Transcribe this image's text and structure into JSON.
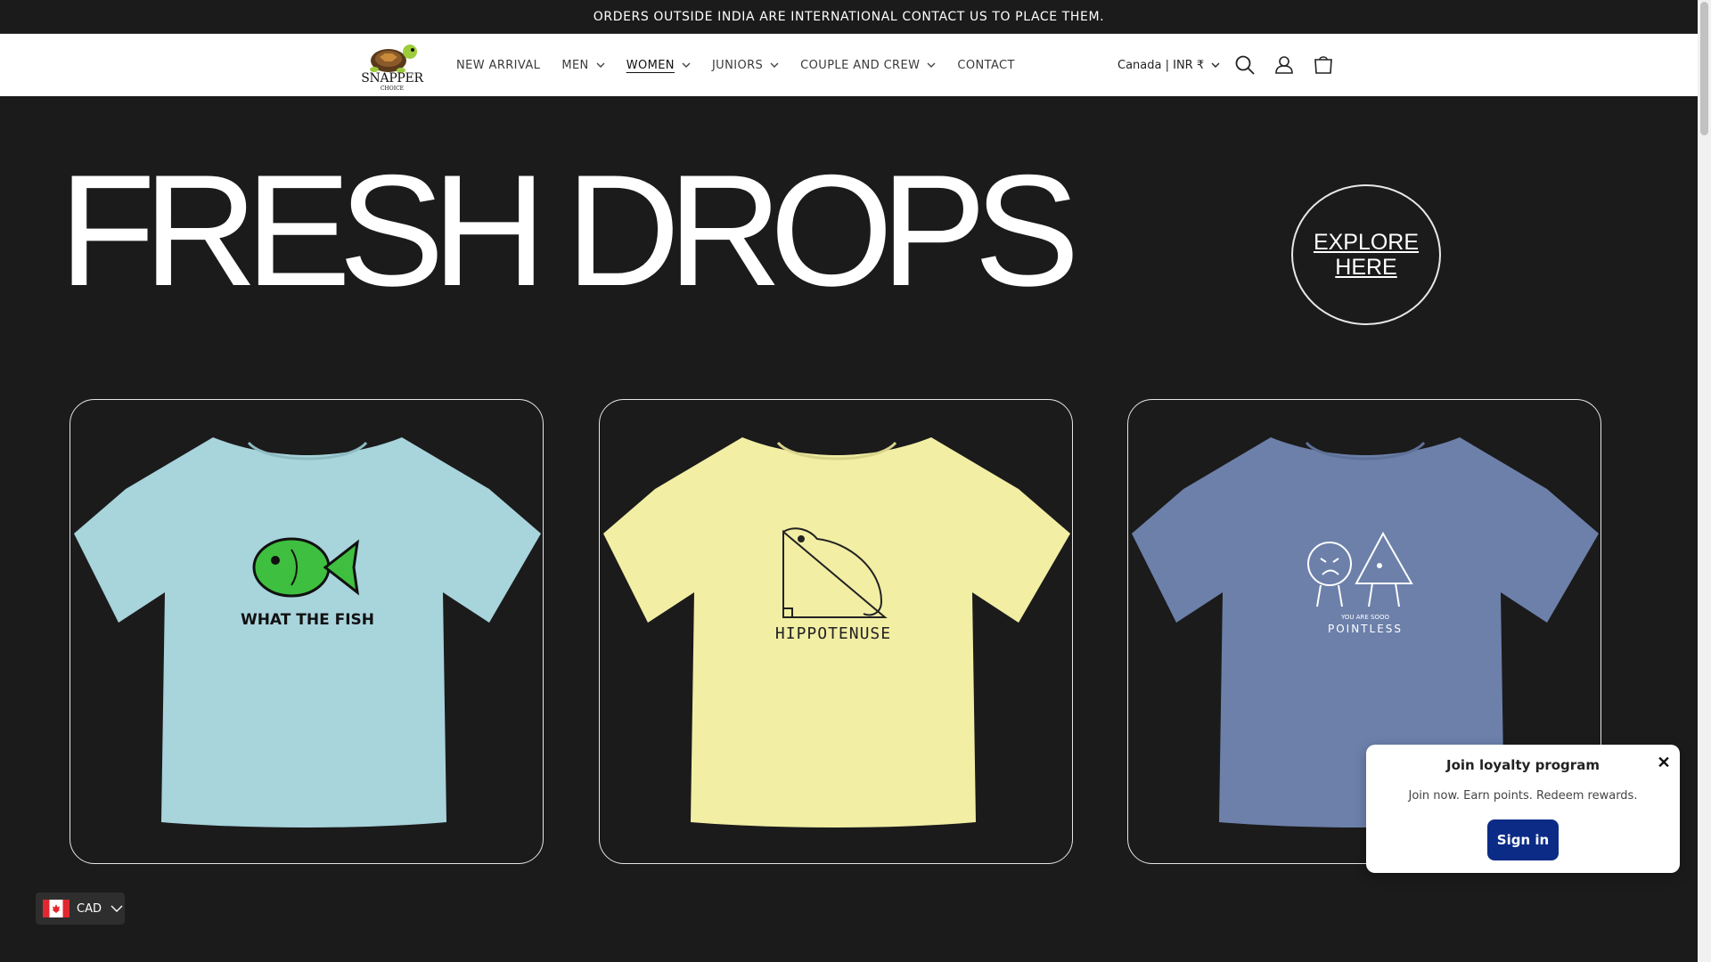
{
  "announcement": {
    "text": "ORDERS OUTSIDE INDIA ARE INTERNATIONAL CONTACT US TO PLACE THEM."
  },
  "brand": {
    "name": "SNAPPER",
    "tagline": "CHOICE"
  },
  "nav": {
    "items": [
      {
        "label": "NEW ARRIVAL",
        "dropdown": false
      },
      {
        "label": "MEN",
        "dropdown": true
      },
      {
        "label": "WOMEN",
        "dropdown": true,
        "active": true
      },
      {
        "label": "JUNIORS",
        "dropdown": true
      },
      {
        "label": "COUPLE AND CREW",
        "dropdown": true
      },
      {
        "label": "CONTACT",
        "dropdown": false
      }
    ]
  },
  "country_selector": {
    "label": "Canada | INR ₹"
  },
  "header_icons": [
    "search-icon",
    "account-icon",
    "cart-icon"
  ],
  "hero": {
    "title": "FRESH DROPS",
    "cta": "EXPLORE HERE"
  },
  "products": [
    {
      "shirt_color": "#a8d4dc",
      "print_text": "WHAT THE FISH",
      "print_color": "#111111"
    },
    {
      "shirt_color": "#f2eea4",
      "print_text": "HIPPOTENUSE",
      "print_color": "#222222"
    },
    {
      "shirt_color": "#6c80aa",
      "print_text": "POINTLESS",
      "print_small": "YOU ARE SOOO",
      "print_color": "#ffffff"
    }
  ],
  "loyalty": {
    "title": "Join loyalty program",
    "subtitle": "Join now. Earn points. Redeem rewards.",
    "button": "Sign in",
    "close": "✕"
  },
  "currency": {
    "code": "CAD"
  },
  "colors": {
    "background": "#1b1b1b",
    "accent": "#0b2b86",
    "header_bg": "#ffffff"
  }
}
